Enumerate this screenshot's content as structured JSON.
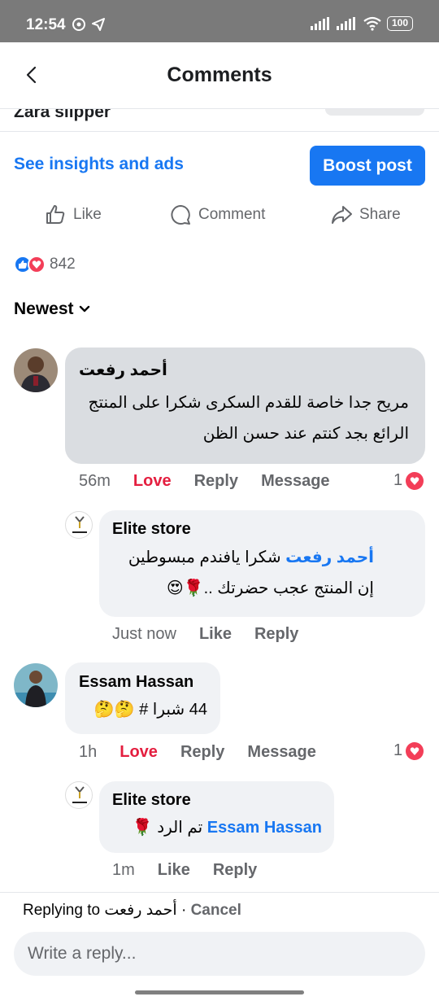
{
  "status_bar": {
    "time": "12:54",
    "battery": "100"
  },
  "header": {
    "title": "Comments"
  },
  "post": {
    "title": "Zara slipper"
  },
  "insights": {
    "link": "See insights and ads",
    "boost": "Boost post"
  },
  "actions": {
    "like": "Like",
    "comment": "Comment",
    "share": "Share"
  },
  "reactions": {
    "count": "842"
  },
  "sort": {
    "label": "Newest"
  },
  "comments": [
    {
      "author": "أحمد رفعت",
      "text": "مريح جدا خاصة للقدم السكرى شكرا على المنتج الرائع بجد كنتم عند حسن الظن",
      "time": "56m",
      "reaction": "Love",
      "reply": "Reply",
      "message": "Message",
      "react_count": "1",
      "reply_item": {
        "author": "Elite store",
        "mention": "أحمد رفعت",
        "text": "شكرا يافندم مبسوطين إن المنتج عجب حضرتك ..🌹😍",
        "time": "Just now",
        "like": "Like",
        "reply": "Reply"
      }
    },
    {
      "author": "Essam Hassan",
      "text": "44 شبرا # 🤔🤔",
      "time": "1h",
      "reaction": "Love",
      "reply": "Reply",
      "message": "Message",
      "react_count": "1",
      "reply_item": {
        "author": "Elite store",
        "mention": "Essam Hassan",
        "text": "تم الرد 🌹",
        "time": "1m",
        "like": "Like",
        "reply": "Reply"
      }
    }
  ],
  "reply_bar": {
    "replying_prefix": "Replying to",
    "replying_name": "أحمد رفعت",
    "separator": "·",
    "cancel": "Cancel",
    "placeholder": "Write a reply..."
  },
  "colors": {
    "accent": "#1877f2",
    "love": "#e41e3f",
    "bubble": "#f0f2f5",
    "status_bar": "#7a7a7a"
  }
}
